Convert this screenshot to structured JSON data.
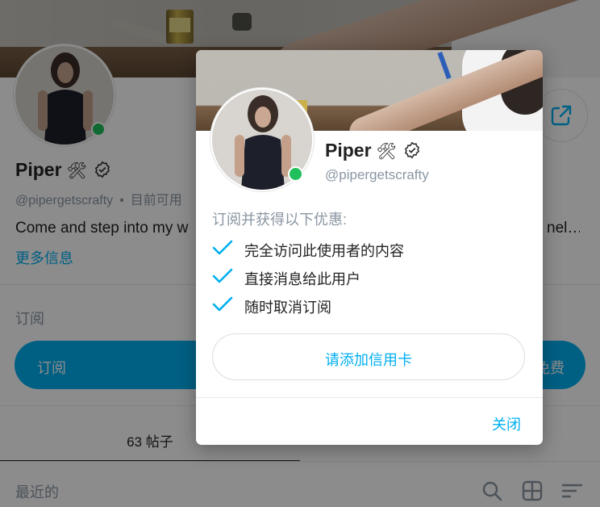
{
  "profile": {
    "name": "Piper",
    "name_emoji": "🛠",
    "handle": "@pipergetscrafty",
    "separator": "•",
    "availability": "目前可用",
    "bio": "Come and step into my w",
    "bio_tail": "nel…",
    "more_info": "更多信息"
  },
  "subscription": {
    "label": "订阅",
    "button_left": "订阅",
    "button_right": "免费"
  },
  "tabs": {
    "posts": "63 帖子"
  },
  "feed": {
    "sort_label": "最近的"
  },
  "modal": {
    "name": "Piper",
    "name_emoji": "🛠",
    "handle": "@pipergetscrafty",
    "benefits_title": "订阅并获得以下优惠:",
    "benefits": [
      "完全访问此使用者的内容",
      "直接消息给此用户",
      "随时取消订阅"
    ],
    "add_card_button": "请添加信用卡",
    "close_button": "关闭"
  },
  "colors": {
    "accent": "#00aff0",
    "online": "#20c05c",
    "muted_text": "#8a96a3",
    "overlay": "rgba(0,0,0,0.45)"
  },
  "icons": {
    "verified": "verified-badge-icon",
    "share": "share-icon",
    "search": "search-icon",
    "grid": "grid-icon",
    "sort": "sort-icon",
    "check": "check-icon"
  }
}
